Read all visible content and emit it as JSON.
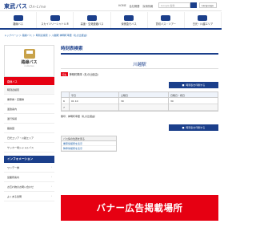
{
  "header": {
    "logo_main": "東武バス",
    "logo_sub": "On-Line",
    "toplinks": [
      "HOME",
      "会社概要",
      "採用情報"
    ],
    "search_placeholder": "Google 提供",
    "language_label": "Language"
  },
  "gnav": {
    "items": [
      {
        "label": "路線バス",
        "icon": "bus-icon"
      },
      {
        "label": "スカイツリーシャトル®",
        "icon": "shuttle-icon"
      },
      {
        "label": "高速・空港連絡バス",
        "icon": "highway-bus-icon"
      },
      {
        "label": "深夜急行バス",
        "icon": "night-bus-icon"
      },
      {
        "label": "貸切バス・ツアー",
        "icon": "charter-bus-icon"
      },
      {
        "label": "日光・川越エリア",
        "icon": "area-icon"
      }
    ]
  },
  "breadcrumb": "トップページ ＞ 路線バス ＞ 時刻表検索 ＞ 川越駅 神明町車庫（札の辻経由）",
  "sidebar": {
    "title": "路線バス",
    "subtitle": "route bus",
    "active_item": "路線バス",
    "items": [
      "時刻表検索",
      "乗車券・定期券",
      "運賃案内",
      "運行情報",
      "路線図",
      "日光エリア・川越エリア",
      "サッカー場シャトルバス"
    ],
    "info_header": "インフォメーション",
    "info_items": [
      "ワンデー券",
      "営業所案内",
      "お忘れ物のお問い合わせ",
      "よくある質問"
    ]
  },
  "main": {
    "title": "時刻表検索",
    "station": "川越駅",
    "route_tag": "行先",
    "route_name": "神明町車庫（札の辻経由）",
    "print_label": "時刻表を印刷する",
    "timetable": {
      "columns": [
        "平日",
        "土曜日",
        "日曜日・祝日"
      ],
      "rows": [
        {
          "hour": "6",
          "values": [
            "01 10",
            "30",
            "30"
          ]
        },
        {
          "hour": "7",
          "values": [
            "",
            "",
            ""
          ]
        }
      ]
    },
    "legend": "無印：神明町車庫（札の辻経由）",
    "print_label_2": "時刻表を印刷する",
    "notes": {
      "header": "バス停の位置を見る",
      "items": [
        "乗車停留所を表示",
        "降車停留所を表示"
      ]
    }
  },
  "banner": "バナー広告掲載場所",
  "colors": {
    "brand": "#1b3f8b",
    "accent": "#e60012"
  }
}
